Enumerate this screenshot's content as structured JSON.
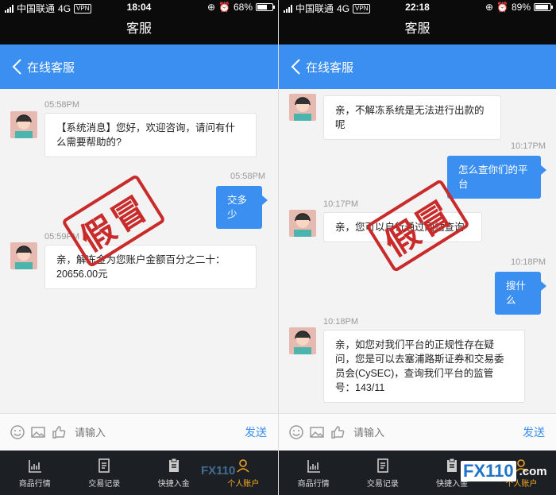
{
  "left": {
    "status": {
      "carrier": "中国联通",
      "network": "4G",
      "vpn": "VPN",
      "time": "18:04",
      "battery": "68%",
      "battery_level": 0.68
    },
    "title": "客服",
    "nav": {
      "back_label": "在线客服"
    },
    "messages": [
      {
        "time": "05:58PM",
        "text": "【系统消息】您好，欢迎咨询，请问有什么需要帮助的?"
      },
      {
        "time": "05:58PM",
        "text": "交多少"
      },
      {
        "time": "05:59PM",
        "text": "亲，解冻金为您账户金额百分之二十：20656.00元"
      }
    ],
    "input": {
      "placeholder": "请输入",
      "send": "发送"
    },
    "tabs": [
      "商品行情",
      "交易记录",
      "快捷入金",
      "个人账户"
    ]
  },
  "right": {
    "status": {
      "carrier": "中国联通",
      "network": "4G",
      "vpn": "VPN",
      "time": "22:18",
      "battery": "89%",
      "battery_level": 0.89
    },
    "title": "客服",
    "nav": {
      "back_label": "在线客服"
    },
    "messages": [
      {
        "time": "",
        "text": "亲，不解冻系统是无法进行出款的呢"
      },
      {
        "time": "10:17PM",
        "text": "怎么查你们的平台"
      },
      {
        "time": "10:17PM",
        "text": "亲，您可以自行通过网站查询"
      },
      {
        "time": "10:18PM",
        "text": "搜什么"
      },
      {
        "time": "10:18PM",
        "text": "亲，如您对我们平台的正规性存在疑问，您是可以去塞浦路斯证券和交易委员会(CySEC)，查询我们平台的监管号：143/11"
      }
    ],
    "input": {
      "placeholder": "请输入",
      "send": "发送"
    },
    "tabs": [
      "商品行情",
      "交易记录",
      "快捷入金",
      "个人账户"
    ]
  },
  "stamp_text": "假冒",
  "watermark": {
    "brand": "FX110",
    "suffix": ".com"
  },
  "colors": {
    "accent": "#3b8ff0",
    "stamp": "#c92a2a",
    "tab_active": "#f5a623"
  }
}
